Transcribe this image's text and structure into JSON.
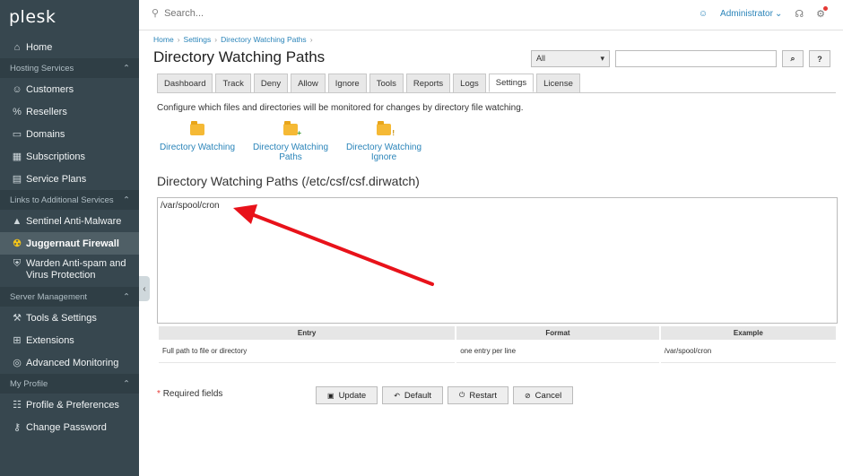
{
  "sidebar": {
    "logo": "plesk",
    "items": [
      {
        "label": "Home",
        "icon": "home-icon"
      },
      {
        "section": "Hosting Services"
      },
      {
        "label": "Customers",
        "icon": "user-icon"
      },
      {
        "label": "Resellers",
        "icon": "percent-icon"
      },
      {
        "label": "Domains",
        "icon": "monitor-icon"
      },
      {
        "label": "Subscriptions",
        "icon": "grid-icon"
      },
      {
        "label": "Service Plans",
        "icon": "plans-icon"
      },
      {
        "section": "Links to Additional Services"
      },
      {
        "label": "Sentinel Anti-Malware",
        "icon": "sentinel-icon"
      },
      {
        "label": "Juggernaut Firewall",
        "icon": "firewall-icon"
      },
      {
        "label": "Warden Anti-spam and Virus Protection",
        "icon": "shield-icon"
      },
      {
        "section": "Server Management"
      },
      {
        "label": "Tools & Settings",
        "icon": "tools-icon"
      },
      {
        "label": "Extensions",
        "icon": "extensions-icon"
      },
      {
        "label": "Advanced Monitoring",
        "icon": "monitoring-icon"
      },
      {
        "section": "My Profile"
      },
      {
        "label": "Profile & Preferences",
        "icon": "profile-icon"
      },
      {
        "label": "Change Password",
        "icon": "key-icon"
      }
    ]
  },
  "topbar": {
    "search_placeholder": "Search...",
    "user": "Administrator"
  },
  "breadcrumb": [
    "Home",
    "Settings",
    "Directory Watching Paths"
  ],
  "page_title": "Directory Watching Paths",
  "filter": {
    "select_value": "All",
    "search_button": "⌕",
    "help_button": "?"
  },
  "tabs": [
    "Dashboard",
    "Track",
    "Deny",
    "Allow",
    "Ignore",
    "Tools",
    "Reports",
    "Logs",
    "Settings",
    "License"
  ],
  "active_tab": "Settings",
  "description": "Configure which files and directories will be monitored for changes by directory file watching.",
  "quick_links": [
    {
      "label": "Directory Watching"
    },
    {
      "label": "Directory Watching Paths"
    },
    {
      "label": "Directory Watching Ignore"
    }
  ],
  "section_title": "Directory Watching Paths (/etc/csf/csf.dirwatch)",
  "textarea_value": "/var/spool/cron",
  "table": {
    "headers": [
      "Entry",
      "Format",
      "Example"
    ],
    "row": [
      "Full path to file or directory",
      "one entry per line",
      "/var/spool/cron"
    ]
  },
  "required_label": "Required fields",
  "buttons": {
    "update": "Update",
    "default": "Default",
    "restart": "Restart",
    "cancel": "Cancel"
  },
  "colors": {
    "sidebar_bg": "#37474f",
    "link": "#2a84b9",
    "annotation_arrow": "#e8121a"
  }
}
